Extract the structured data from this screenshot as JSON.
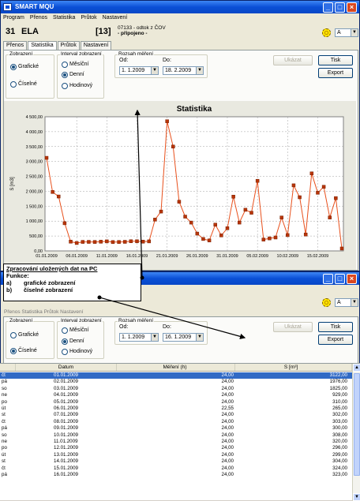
{
  "window1": {
    "title": "SMART MQU",
    "menu": [
      "Program",
      "Přenos",
      "Statistika",
      "Průtok",
      "Nastavení"
    ],
    "device_number": "31",
    "device_name": "ELA",
    "device_id": "[13]",
    "device_desc": "07133 - odtok z ČOV",
    "device_status": "- připojeno -",
    "mode_select": "A",
    "tabs": [
      "Přenos",
      "Statistika",
      "Průtok",
      "Nastavení"
    ],
    "active_tab": "Statistika",
    "zobrazeni": {
      "title": "Zobrazení",
      "opt1": "Grafické",
      "opt2": "Číselné"
    },
    "interval": {
      "title": "Interval zobrazení",
      "opt1": "Měsíční",
      "opt2": "Denní",
      "opt3": "Hodinový"
    },
    "rozsah": {
      "title": "Rozsah měření",
      "od_label": "Od:",
      "do_label": "Do:",
      "od": "1. 1.2009",
      "do": "18. 2.2009"
    },
    "buttons": {
      "ukazat": "Ukázat",
      "tisk": "Tisk",
      "export": "Export"
    }
  },
  "callout": {
    "title": "Zpracování uložených dat na PC",
    "funkce": "Funkce:",
    "a_key": "a)",
    "a": "grafické zobrazení",
    "b_key": "b)",
    "b": "číselné zobrazení"
  },
  "window2": {
    "menu_partial": "Přenos   Statistika   Průtok   Nastavení",
    "mode_select": "A",
    "zobrazeni": {
      "title": "Zobrazení",
      "opt1": "Grafické",
      "opt2": "Číselné"
    },
    "interval": {
      "title": "Interval zobrazení",
      "opt1": "Měsíční",
      "opt2": "Denní",
      "opt3": "Hodinový"
    },
    "rozsah": {
      "title": "Rozsah měření",
      "od_label": "Od:",
      "do_label": "Do:",
      "od": "1. 1.2009",
      "do": "16. 1.2009"
    },
    "buttons": {
      "ukazat": "Ukázat",
      "tisk": "Tisk",
      "export": "Export"
    },
    "table": {
      "headers": [
        "",
        "Datum",
        "Měření (h)",
        "S [m³]"
      ],
      "rows": [
        [
          "čt",
          "01.01.2009",
          "24,00",
          "3122,00"
        ],
        [
          "pá",
          "02.01.2009",
          "24,00",
          "1976,00"
        ],
        [
          "so",
          "03.01.2009",
          "24,00",
          "1825,00"
        ],
        [
          "ne",
          "04.01.2009",
          "24,00",
          "929,00"
        ],
        [
          "po",
          "05.01.2009",
          "24,00",
          "310,00"
        ],
        [
          "út",
          "06.01.2009",
          "22,55",
          "265,00"
        ],
        [
          "st",
          "07.01.2009",
          "24,00",
          "302,00"
        ],
        [
          "čt",
          "08.01.2009",
          "24,00",
          "303,00"
        ],
        [
          "pá",
          "09.01.2009",
          "24,00",
          "300,00"
        ],
        [
          "so",
          "10.01.2009",
          "24,00",
          "308,00"
        ],
        [
          "ne",
          "11.01.2009",
          "24,00",
          "320,00"
        ],
        [
          "po",
          "12.01.2009",
          "24,00",
          "296,00"
        ],
        [
          "út",
          "13.01.2009",
          "24,00",
          "299,00"
        ],
        [
          "st",
          "14.01.2009",
          "24,00",
          "304,00"
        ],
        [
          "čt",
          "15.01.2009",
          "24,00",
          "324,00"
        ],
        [
          "pá",
          "16.01.2009",
          "24,00",
          "323,00"
        ]
      ]
    }
  },
  "colors": {
    "line": "#e8501c",
    "marker": "#b8350a",
    "plot_bg": "#ffffff",
    "grid": "#a0a0a0",
    "selection": "#316ac5"
  },
  "chart_data": {
    "type": "line",
    "title": "Statistika",
    "ylabel": "S [m3]",
    "ylim": [
      0,
      4500
    ],
    "yticks": [
      "0,00",
      "500,00",
      "1 000,00",
      "1 500,00",
      "2 000,00",
      "2 500,00",
      "3 000,00",
      "3 500,00",
      "4 000,00",
      "4 500,00"
    ],
    "xticks": [
      "01.01.2009",
      "06.01.2009",
      "11.01.2009",
      "16.01.2009",
      "21.01.2009",
      "26.01.2009",
      "31.01.2009",
      "05.02.2009",
      "10.02.2009",
      "15.02.2009"
    ],
    "x_start": "01.01.2009",
    "x_end": "18.02.2009",
    "values": [
      3122,
      1976,
      1825,
      929,
      310,
      265,
      302,
      303,
      300,
      308,
      320,
      296,
      299,
      304,
      324,
      323,
      310,
      320,
      1050,
      1320,
      4350,
      3500,
      1650,
      1150,
      950,
      580,
      400,
      350,
      880,
      520,
      760,
      1820,
      950,
      1380,
      1280,
      2350,
      380,
      420,
      450,
      1120,
      530,
      2200,
      1800,
      550,
      2600,
      1950,
      2150,
      1120,
      1770,
      80
    ]
  }
}
